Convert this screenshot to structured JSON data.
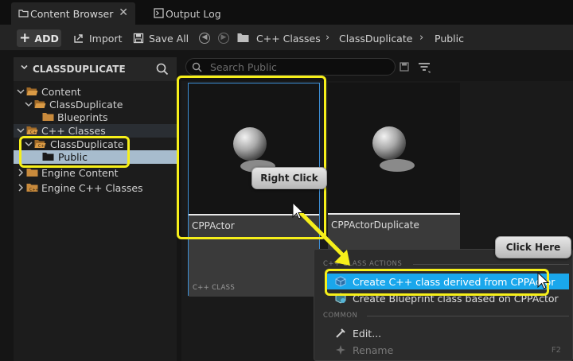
{
  "tabs": [
    {
      "label": "Content Browser",
      "close": "✕"
    },
    {
      "label": "Output Log"
    }
  ],
  "toolbar": {
    "add_label": "ADD",
    "add_symbol": "+",
    "import_label": "Import",
    "save_all_label": "Save All",
    "breadcrumb": [
      "C++ Classes",
      "ClassDuplicate",
      "Public"
    ]
  },
  "sidebar": {
    "title": "CLASSDUPLICATE",
    "tree": [
      "Content",
      "ClassDuplicate",
      "Blueprints",
      "C++ Classes",
      "ClassDuplicate",
      "Public",
      "Engine Content",
      "Engine C++ Classes"
    ]
  },
  "search": {
    "placeholder": "Search Public"
  },
  "assets": [
    {
      "name": "CPPActor",
      "type": "C++ CLASS"
    },
    {
      "name": "CPPActorDuplicate"
    }
  ],
  "context_menu": {
    "section1": "C++ CLASS ACTIONS",
    "items1": [
      "Create C++ class derived from CPPActor",
      "Create Blueprint class based on CPPActor"
    ],
    "section2": "COMMON",
    "items2": [
      {
        "label": "Edit..."
      },
      {
        "label": "Rename",
        "shortcut": "F2"
      }
    ]
  },
  "annotations": {
    "right_click": "Right Click",
    "click_here": "Click Here"
  },
  "colors": {
    "highlight_yellow": "#f6ef1a",
    "selection_blue": "#1aa7ec",
    "folder_orange": "#c88a3c",
    "tile_border_blue": "#3d8fd6"
  }
}
